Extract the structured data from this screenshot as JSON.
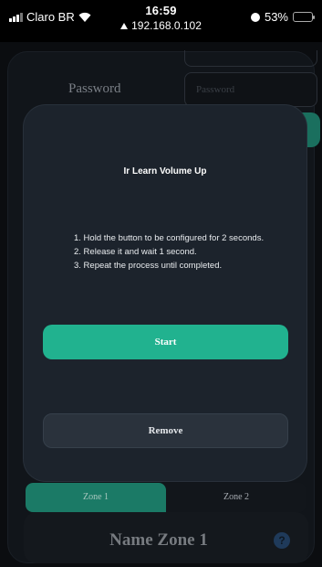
{
  "status_bar": {
    "carrier": "Claro BR",
    "time": "16:59",
    "url": "192.168.0.102",
    "battery_percent": "53%",
    "battery_level": 0.53
  },
  "background": {
    "password_label": "Password",
    "password_placeholder": "Password",
    "tabs": [
      {
        "label": "Zone 1",
        "active": true
      },
      {
        "label": "Zone 2",
        "active": false
      }
    ],
    "zone_name": "Name Zone 1",
    "help_glyph": "?"
  },
  "modal": {
    "title": "Ir Learn Volume Up",
    "steps": [
      "1.  Hold the button to be configured for 2 seconds.",
      "2.  Release it and wait 1 second.",
      "3.  Repeat the process until completed."
    ],
    "start_label": "Start",
    "remove_label": "Remove"
  },
  "colors": {
    "accent": "#21b28f",
    "modal_bg": "#1c232c",
    "button_secondary": "#2a323c"
  }
}
